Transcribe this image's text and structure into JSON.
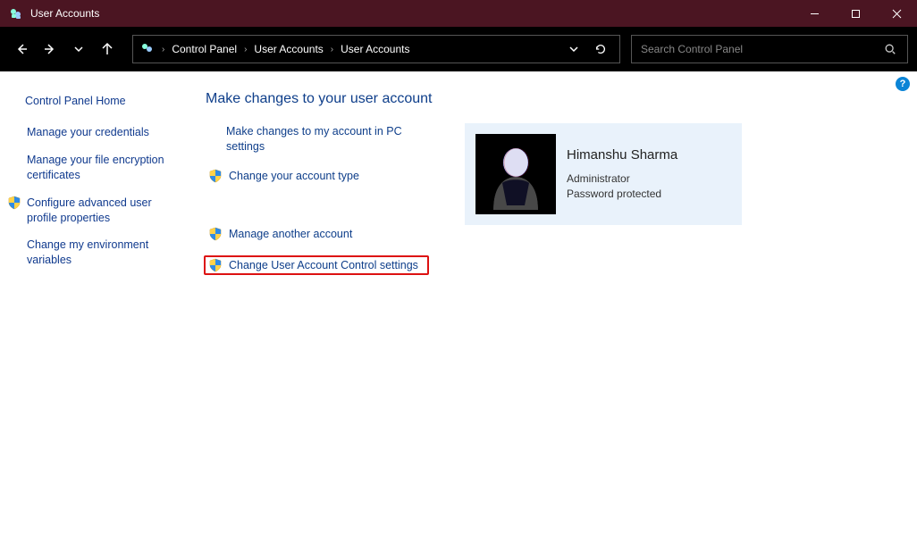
{
  "window": {
    "title": "User Accounts"
  },
  "breadcrumb": {
    "items": [
      "Control Panel",
      "User Accounts",
      "User Accounts"
    ]
  },
  "search": {
    "placeholder": "Search Control Panel"
  },
  "sidebar": {
    "home": "Control Panel Home",
    "items": [
      {
        "label": "Manage your credentials",
        "shield": false
      },
      {
        "label": "Manage your file encryption certificates",
        "shield": false
      },
      {
        "label": "Configure advanced user profile properties",
        "shield": true
      },
      {
        "label": "Change my environment variables",
        "shield": false
      }
    ]
  },
  "main": {
    "heading": "Make changes to your user account",
    "tasks": [
      {
        "label": "Make changes to my account in PC settings",
        "shield": false
      },
      {
        "label": "Change your account type",
        "shield": true
      },
      {
        "label": "Manage another account",
        "shield": true
      },
      {
        "label": "Change User Account Control settings",
        "shield": true,
        "highlight": true
      }
    ]
  },
  "user": {
    "name": "Himanshu Sharma",
    "role": "Administrator",
    "status": "Password protected"
  },
  "help": {
    "symbol": "?"
  }
}
